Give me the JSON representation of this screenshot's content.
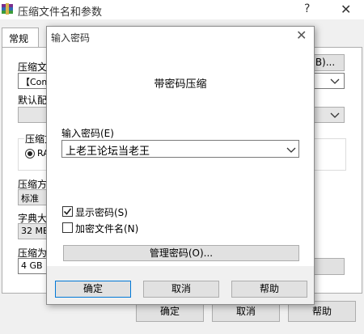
{
  "background_window": {
    "title": "压缩文件名和参数",
    "help_label": "?",
    "close_label": "✕",
    "tab_general": "常规",
    "labels": {
      "archive_name": "压缩文",
      "default_profile": "默认配",
      "format_group": "压缩文",
      "method": "压缩方",
      "dictionary": "字典大",
      "split": "压缩为"
    },
    "archive_name_value": "【Coms",
    "format_radio_label": "RA",
    "method_value": "标准",
    "dictionary_value": "32 MB",
    "split_value": "4 GB",
    "browse_button_label": "B)...",
    "ok_button": "确定",
    "cancel_button": "取消",
    "help_button": "帮助"
  },
  "dialog": {
    "title": "输入密码",
    "close_label": "✕",
    "heading": "带密码压缩",
    "password_label": "输入密码(E)",
    "password_value": "上老王论坛当老王",
    "show_password_label": "显示密码(S)",
    "show_password_checked": true,
    "encrypt_filenames_label": "加密文件名(N)",
    "encrypt_filenames_checked": false,
    "manage_passwords_button": "管理密码(O)...",
    "ok_button": "确定",
    "cancel_button": "取消",
    "help_button": "帮助"
  }
}
